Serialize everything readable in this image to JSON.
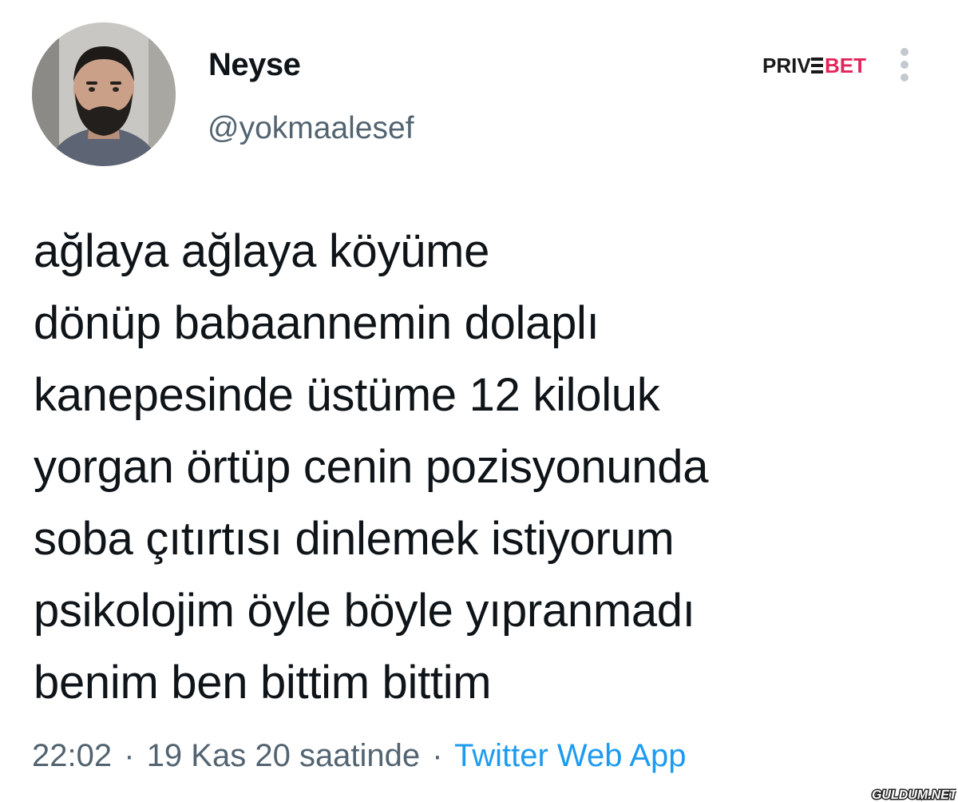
{
  "tweet": {
    "author": {
      "display_name": "Neyse",
      "handle": "@yokmaalesef"
    },
    "text": "ağlaya ağlaya köyüme\ndönüp babaannemin dolaplı\nkanepesinde üstüme 12 kiloluk\nyorgan örtüp cenin pozisyonunda\nsoba çıtırtısı dinlemek istiyorum\npsikolojim öyle böyle yıpranmadı\nbenim ben bittim bittim",
    "time": "22:02",
    "separator": "·",
    "date": "19 Kas 20 saatinde",
    "source": "Twitter Web App"
  },
  "watermarks": {
    "brand": "PRIVEBET",
    "site": "GULDUM.NET"
  },
  "icons": {
    "more": "more-vertical-icon",
    "avatar": "profile-photo"
  },
  "colors": {
    "text": "#0f1419",
    "secondary": "#536471",
    "link": "#1d9bf0",
    "brand_accent": "#e3245a"
  }
}
